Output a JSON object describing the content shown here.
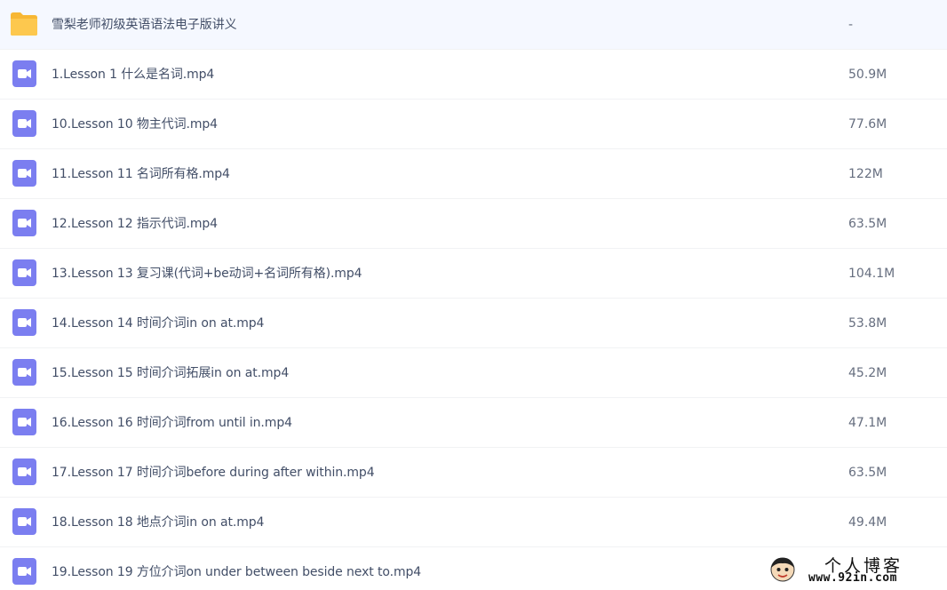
{
  "colors": {
    "folder": "#fdc84e",
    "video": "#7b7ef0",
    "text": "#424e67",
    "divider": "#f1f2f4"
  },
  "files": [
    {
      "icon": "folder-icon",
      "name": "雪梨老师初级英语语法电子版讲义",
      "size": "-"
    },
    {
      "icon": "video-file-icon",
      "name": "1.Lesson 1 什么是名词.mp4",
      "size": "50.9M"
    },
    {
      "icon": "video-file-icon",
      "name": "10.Lesson 10 物主代词.mp4",
      "size": "77.6M"
    },
    {
      "icon": "video-file-icon",
      "name": "11.Lesson 11 名词所有格.mp4",
      "size": "122M"
    },
    {
      "icon": "video-file-icon",
      "name": "12.Lesson 12 指示代词.mp4",
      "size": "63.5M"
    },
    {
      "icon": "video-file-icon",
      "name": "13.Lesson 13 复习课(代词+be动词+名词所有格).mp4",
      "size": "104.1M"
    },
    {
      "icon": "video-file-icon",
      "name": "14.Lesson 14 时间介词in on at.mp4",
      "size": "53.8M"
    },
    {
      "icon": "video-file-icon",
      "name": "15.Lesson 15 时间介词拓展in on at.mp4",
      "size": "45.2M"
    },
    {
      "icon": "video-file-icon",
      "name": "16.Lesson 16 时间介词from until in.mp4",
      "size": "47.1M"
    },
    {
      "icon": "video-file-icon",
      "name": "17.Lesson 17 时间介词before during after within.mp4",
      "size": "63.5M"
    },
    {
      "icon": "video-file-icon",
      "name": "18.Lesson 18 地点介词in on at.mp4",
      "size": "49.4M"
    },
    {
      "icon": "video-file-icon",
      "name": "19.Lesson 19 方位介词on under between beside next to.mp4",
      "size": ""
    }
  ],
  "watermark": {
    "title": "个人博客",
    "url": "www.92in.com"
  }
}
